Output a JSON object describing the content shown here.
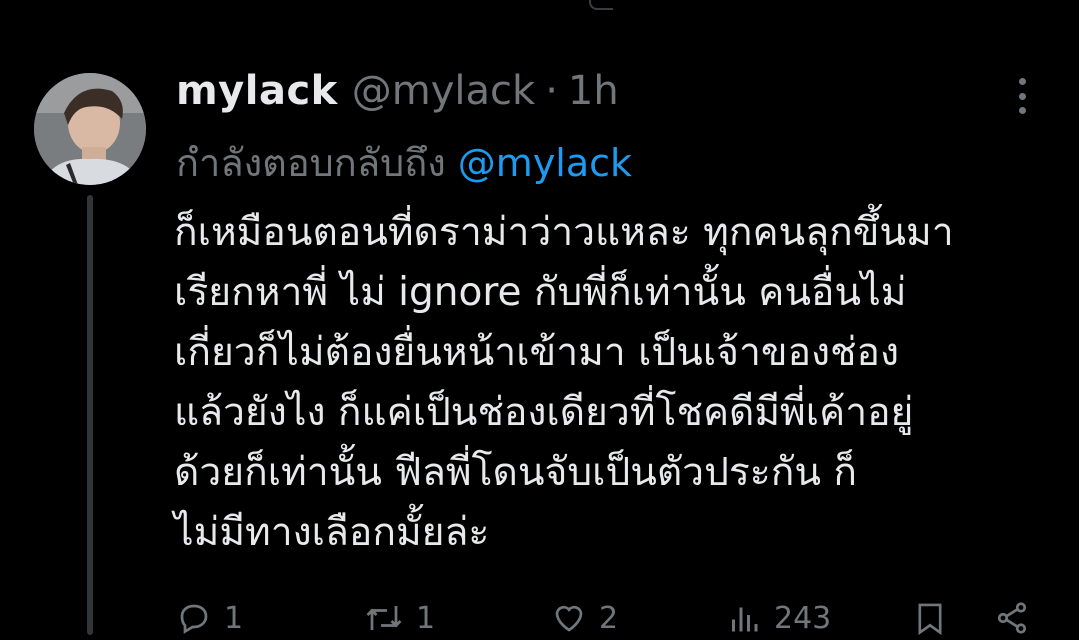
{
  "tweet": {
    "display_name": "mylack",
    "handle": "@mylack",
    "separator": "·",
    "time": "1h",
    "replying_label": "กำลังตอบกลับถึง",
    "replying_to": "@mylack",
    "text_lines": [
      "ก็เหมือนตอนที่ดราม่าว่าวแหละ ทุกคนลุกขึ้นมา",
      "เรียกหาพี่ ไม่ ignore กับพี่ก็เท่านั้น คนอื่นไม่",
      "เกี่ยวก็ไม่ต้องยื่นหน้าเข้ามา เป็นเจ้าของช่อง",
      "แล้วยังไง ก็แค่เป็นช่องเดียวที่โชคดีมีพี่เค้าอยู่",
      "ด้วยก็เท่านั้น ฟีลพี่โดนจับเป็นตัวประกัน ก็",
      "ไม่มีทางเลือกมั้ยล่ะ"
    ],
    "actions": {
      "reply_count": "1",
      "retweet_count": "1",
      "like_count": "2",
      "views_count": "243"
    }
  },
  "icons": {
    "more": "more-dots-icon",
    "reply": "reply-icon",
    "retweet": "retweet-icon",
    "like": "heart-icon",
    "views": "views-icon",
    "bookmark": "bookmark-icon",
    "share": "share-icon"
  },
  "colors": {
    "background": "#000000",
    "text_primary": "#e7e9ea",
    "text_secondary": "#71767b",
    "accent": "#1d9bf0"
  }
}
